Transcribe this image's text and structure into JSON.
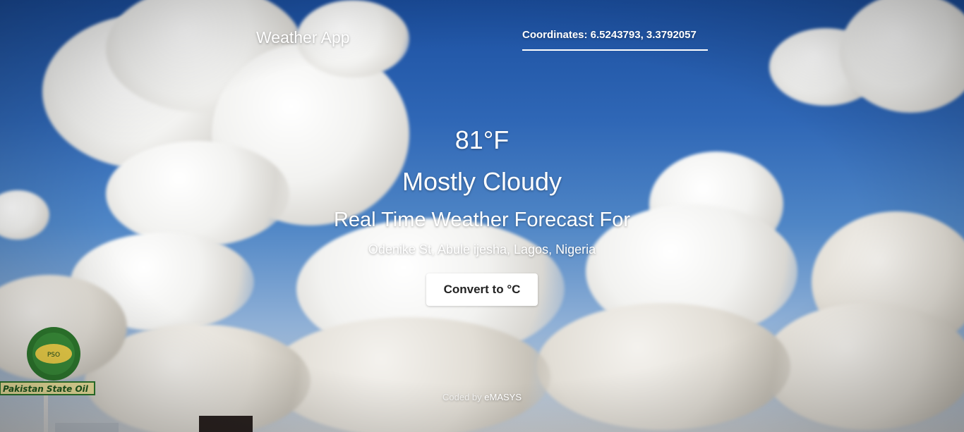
{
  "header": {
    "app_title": "Weather App",
    "coordinates_label": "Coordinates: 6.5243793, 3.3792057"
  },
  "weather": {
    "temperature": "81°F",
    "summary": "Mostly Cloudy",
    "subtitle": "Real Time Weather Forecast For",
    "location": "Odenike St, Abule ijesha, Lagos, Nigeria"
  },
  "actions": {
    "convert_label": "Convert to °C"
  },
  "footer": {
    "credit_prefix": "Coded by",
    "author": "eMASYS"
  },
  "background": {
    "sign_text": "Pakistan State Oil"
  },
  "colors": {
    "sky_top": "#1b4fa0",
    "sky_bottom": "#c9cdd1",
    "text": "#ffffff",
    "button_bg": "#ffffff",
    "button_text": "#222222"
  }
}
